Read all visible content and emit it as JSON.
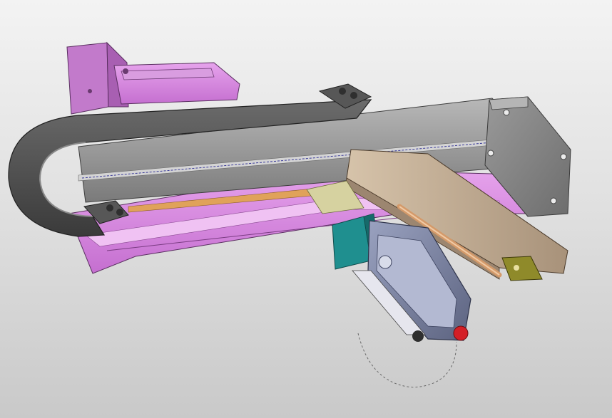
{
  "viewport": {
    "background_top": "#f3f3f3",
    "background_bottom": "#c9c9c9"
  },
  "model": {
    "colors": {
      "motor_mount": "#d98ae0",
      "rail_housing": "#8e8e8e",
      "cable_chain": "#4a4a4a",
      "slider": "#e0a7e8",
      "carriage_plate": "#c7b29a",
      "cylinder": "#1f8f8f",
      "gripper_body": "#8088a6",
      "indicator": "#d41f26",
      "brass_block": "#8f8a2a",
      "copper_rod": "#d49a6a"
    }
  }
}
